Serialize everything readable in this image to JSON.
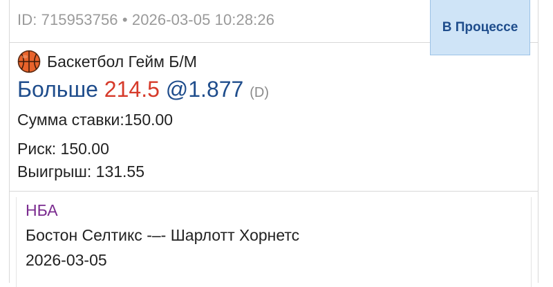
{
  "bet": {
    "id_text": "ID: 715953756 • 2026-03-05 10:28:26",
    "status": "В Процессе",
    "sport": "Баскетбол Гейм Б/М",
    "selection": {
      "name": "Больше",
      "line": "214.5",
      "odds": "@1.877",
      "odds_type": "(D)"
    },
    "stake": "Сумма ставки:150.00",
    "risk": "Риск: 150.00",
    "win": "Выигрыш: 131.55"
  },
  "event": {
    "league": "НБА",
    "match": "Бостон Селтикс -–- Шарлотт Хорнетс",
    "date": "2026-03-05"
  },
  "icons": {
    "sport_icon": "basketball-icon"
  },
  "colors": {
    "status_bg": "#cfe4f7",
    "status_text": "#1f4d8c",
    "selection_blue": "#1f4d8c",
    "line_red": "#d63a2a",
    "league_purple": "#7a2b8f"
  }
}
